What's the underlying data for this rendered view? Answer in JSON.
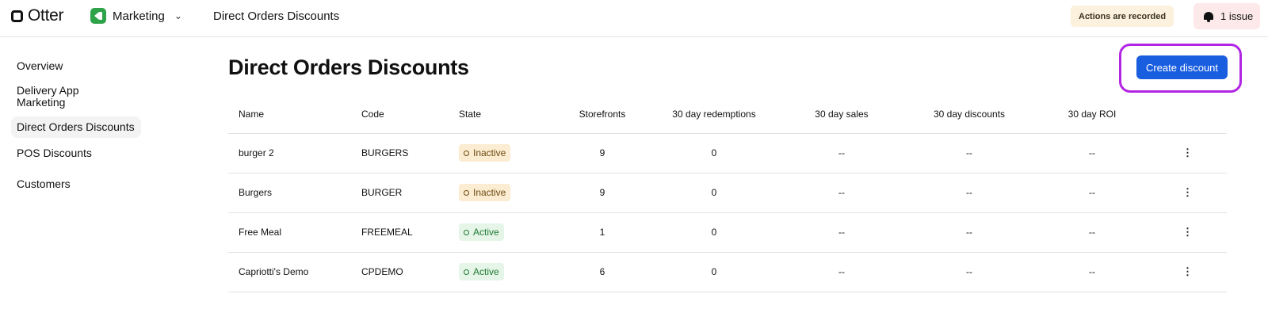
{
  "header": {
    "logo_text": "Otter",
    "workspace": "Marketing",
    "breadcrumb": "Direct Orders Discounts",
    "recorded_label": "Actions are recorded",
    "issue_label": "1 issue"
  },
  "sidebar": {
    "items": [
      {
        "label": "Overview"
      },
      {
        "label": "Delivery App Marketing"
      },
      {
        "label": "Direct Orders Discounts"
      },
      {
        "label": "POS Discounts"
      },
      {
        "label": "Customers"
      }
    ]
  },
  "main": {
    "title": "Direct Orders Discounts",
    "create_button": "Create discount",
    "columns": [
      "Name",
      "Code",
      "State",
      "Storefronts",
      "30 day redemptions",
      "30 day sales",
      "30 day discounts",
      "30 day ROI"
    ],
    "rows": [
      {
        "name": "burger 2",
        "code": "BURGERS",
        "state": "Inactive",
        "storefronts": "9",
        "redemptions": "0",
        "sales": "--",
        "discounts": "--",
        "roi": "--"
      },
      {
        "name": "Burgers",
        "code": "BURGER",
        "state": "Inactive",
        "storefronts": "9",
        "redemptions": "0",
        "sales": "--",
        "discounts": "--",
        "roi": "--"
      },
      {
        "name": "Free Meal",
        "code": "FREEMEAL",
        "state": "Active",
        "storefronts": "1",
        "redemptions": "0",
        "sales": "--",
        "discounts": "--",
        "roi": "--"
      },
      {
        "name": "Capriotti's Demo",
        "code": "CPDEMO",
        "state": "Active",
        "storefronts": "6",
        "redemptions": "0",
        "sales": "--",
        "discounts": "--",
        "roi": "--"
      }
    ]
  },
  "colors": {
    "primary": "#1a5ee0",
    "highlight": "#b225e3",
    "inactive_bg": "#fbecd2",
    "active_bg": "#e5f5e7"
  }
}
